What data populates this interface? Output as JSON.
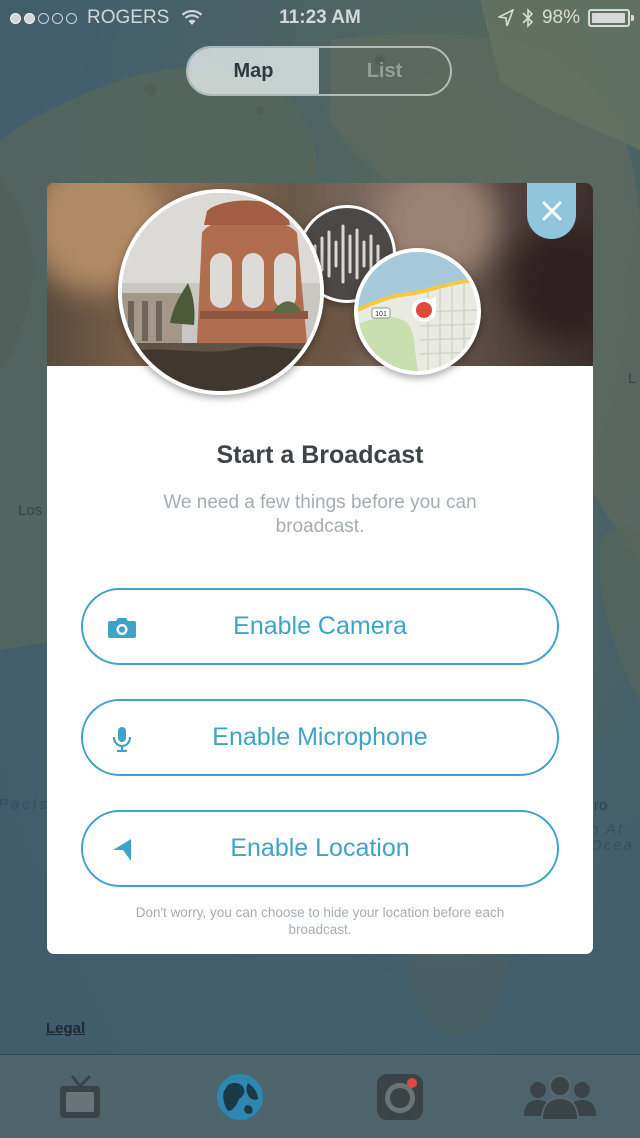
{
  "status_bar": {
    "carrier": "ROGERS",
    "time": "11:23 AM",
    "battery": "98%",
    "battery_level": 0.98,
    "signal_bars": 2,
    "signal_total": 5
  },
  "segmented": {
    "map_label": "Map",
    "list_label": "List",
    "selected": "Map"
  },
  "map": {
    "labels": {
      "los": "Los",
      "l_right": "L",
      "pacific": "Pacis",
      "ro": "ro",
      "h_at": "h At",
      "ocea": "Ocea"
    },
    "legal": "Legal"
  },
  "modal": {
    "title": "Start a Broadcast",
    "subtitle": "We need a few things before you can broadcast.",
    "buttons": {
      "camera": "Enable Camera",
      "microphone": "Enable Microphone",
      "location": "Enable Location"
    },
    "footnote": "Don't worry, you can choose to hide your location before each broadcast.",
    "map_thumb_label": "101"
  },
  "tab_bar": {
    "items": [
      "tv-icon",
      "globe-icon",
      "camera-record-icon",
      "people-icon"
    ],
    "selected": "globe-icon"
  },
  "colors": {
    "accent": "#3ea3c6",
    "close_button": "#8fc6dc",
    "title": "#3d4347",
    "muted_text": "#a4adb3",
    "record_red": "#e04a3c"
  }
}
